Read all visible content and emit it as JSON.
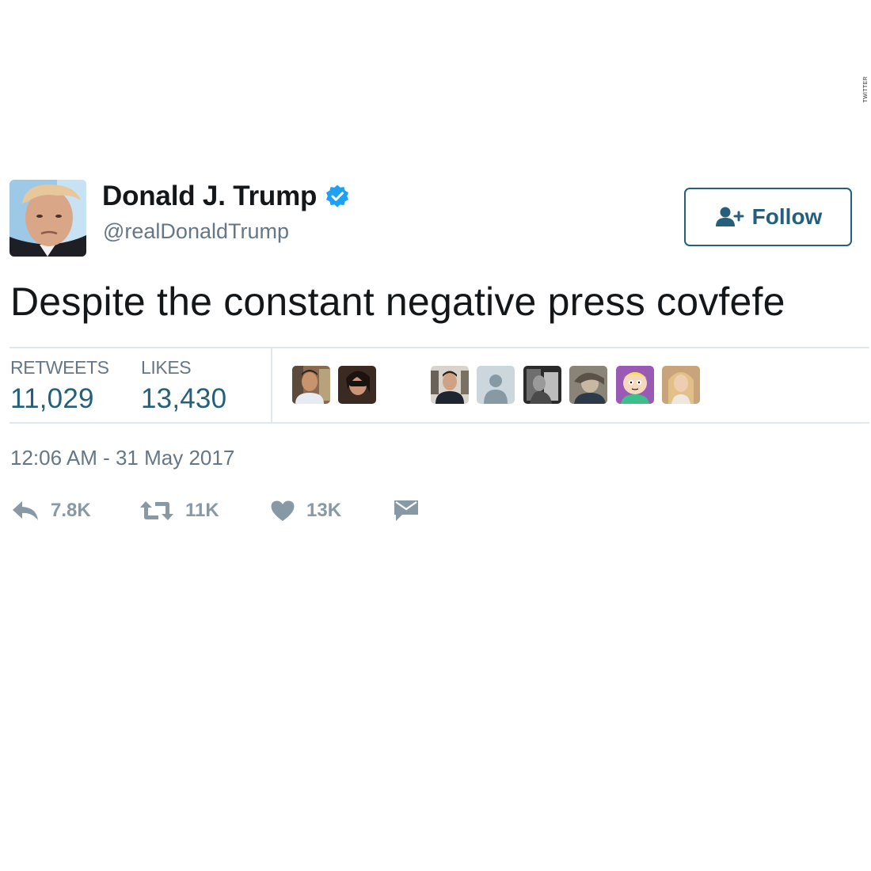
{
  "credit": "TWITTER",
  "tweet": {
    "user": {
      "display_name": "Donald J. Trump",
      "handle": "@realDonaldTrump",
      "verified": true
    },
    "follow_button": {
      "label": "Follow",
      "icon": "add-user-icon"
    },
    "text": "Despite the constant negative press covfefe",
    "stats": {
      "retweets_label": "RETWEETS",
      "retweets_value": "11,029",
      "likes_label": "LIKES",
      "likes_value": "13,430"
    },
    "facepile_count": 8,
    "timestamp": "12:06 AM - 31 May 2017",
    "actions": {
      "reply": {
        "icon": "reply-icon",
        "count": "7.8K"
      },
      "retweet": {
        "icon": "retweet-icon",
        "count": "11K"
      },
      "like": {
        "icon": "heart-icon",
        "count": "13K"
      },
      "message": {
        "icon": "envelope-icon"
      }
    }
  },
  "colors": {
    "text_primary": "#14171a",
    "text_secondary": "#657786",
    "accent": "#24607c",
    "verified": "#1da1f2",
    "action_gray": "#8899a6",
    "divider": "#e1e8ed"
  }
}
